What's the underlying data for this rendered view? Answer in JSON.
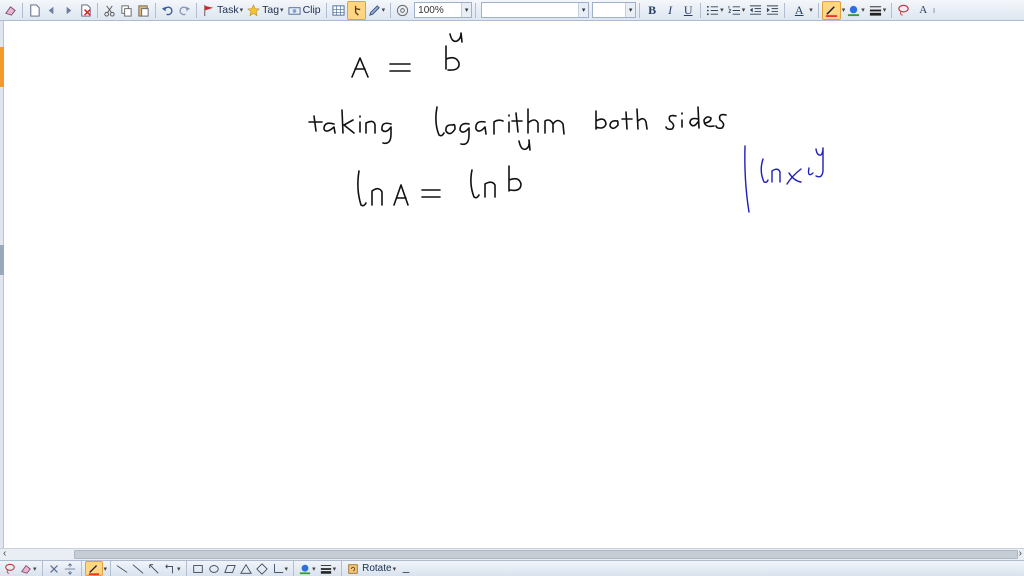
{
  "toolbar": {
    "task_label": "Task",
    "tag_label": "Tag",
    "clip_label": "Clip",
    "zoom_value": "100%",
    "font_name_value": "",
    "font_size_value": "",
    "bold_label": "B",
    "italic_label": "I",
    "underline_label": "U",
    "text_color_label": "A",
    "ai_label": "A"
  },
  "bottombar": {
    "rotate_label": "Rotate"
  },
  "colors": {
    "ink_black": "#111111",
    "ink_blue": "#1f1fb8",
    "active_highlight": "#ffd684",
    "toolbar_bg": "#dde6f1"
  }
}
